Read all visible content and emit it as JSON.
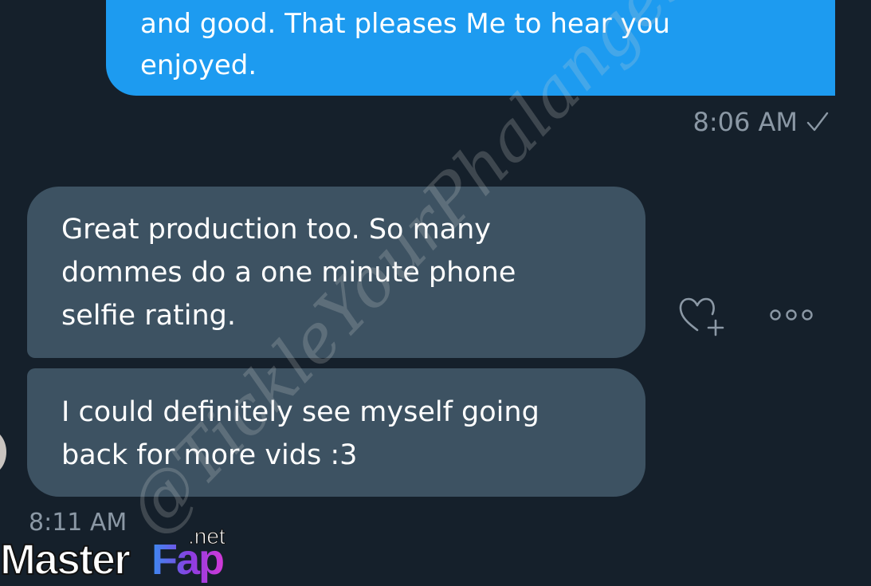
{
  "outgoing_message": {
    "lines": [
      "and good. That pleases Me to hear you",
      "enjoyed."
    ],
    "timestamp": "8:06 AM",
    "status_icon": "check-icon",
    "color": "#1d9bf0"
  },
  "incoming_messages": [
    {
      "lines": [
        "Great production too. So many",
        "dommes do a one minute phone",
        "selfie rating."
      ]
    },
    {
      "lines": [
        "I could definitely see myself going",
        "back for more vids :3"
      ]
    }
  ],
  "incoming_timestamp": "8:11 AM",
  "actions": {
    "react_icon": "heart-add-icon",
    "more_icon": "more-options-icon"
  },
  "watermark": "@TickleYourPhalanges",
  "logo": {
    "main": "Master",
    "accent": "Fap",
    "suffix": ".net"
  },
  "colors": {
    "background": "#15202b",
    "incoming_bubble": "#3d5262",
    "secondary_text": "#8b98a5"
  }
}
